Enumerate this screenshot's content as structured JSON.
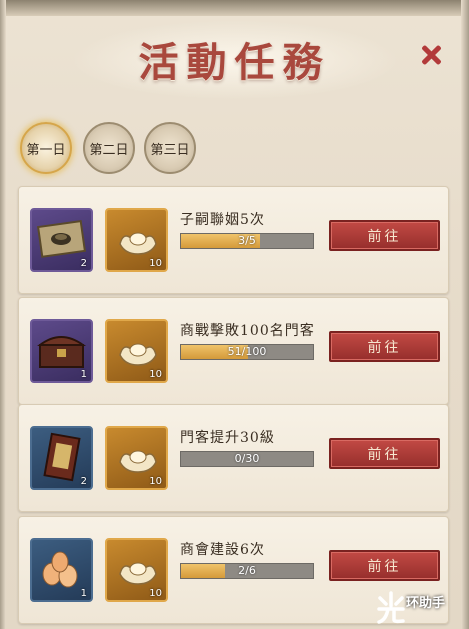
{
  "title": "活動任務",
  "tabs": [
    {
      "label": "第一日",
      "active": true
    },
    {
      "label": "第二日",
      "active": false
    },
    {
      "label": "第三日",
      "active": false
    }
  ],
  "tasks": [
    {
      "name": "子嗣聯姻5次",
      "progress_text": "3/5",
      "progress": 0.6,
      "reward1_qty": "2",
      "reward2_qty": "10",
      "button": "前往",
      "reward1_icon": "seal-box-icon"
    },
    {
      "name": "商戰擊敗100名門客",
      "progress_text": "51/100",
      "progress": 0.51,
      "reward1_qty": "1",
      "reward2_qty": "10",
      "button": "前往",
      "reward1_icon": "treasure-chest-icon"
    },
    {
      "name": "門客提升30級",
      "progress_text": "0/30",
      "progress": 0,
      "reward1_qty": "2",
      "reward2_qty": "10",
      "button": "前往",
      "reward1_icon": "scroll-book-icon"
    },
    {
      "name": "商會建設6次",
      "progress_text": "2/6",
      "progress": 0.333,
      "reward1_qty": "1",
      "reward2_qty": "10",
      "button": "前往",
      "reward1_icon": "eggs-icon"
    }
  ],
  "watermark": "环助手",
  "colors": {
    "accent": "#a9483d",
    "button": "#b23e3a",
    "bar_fill": "#e2ae52"
  }
}
